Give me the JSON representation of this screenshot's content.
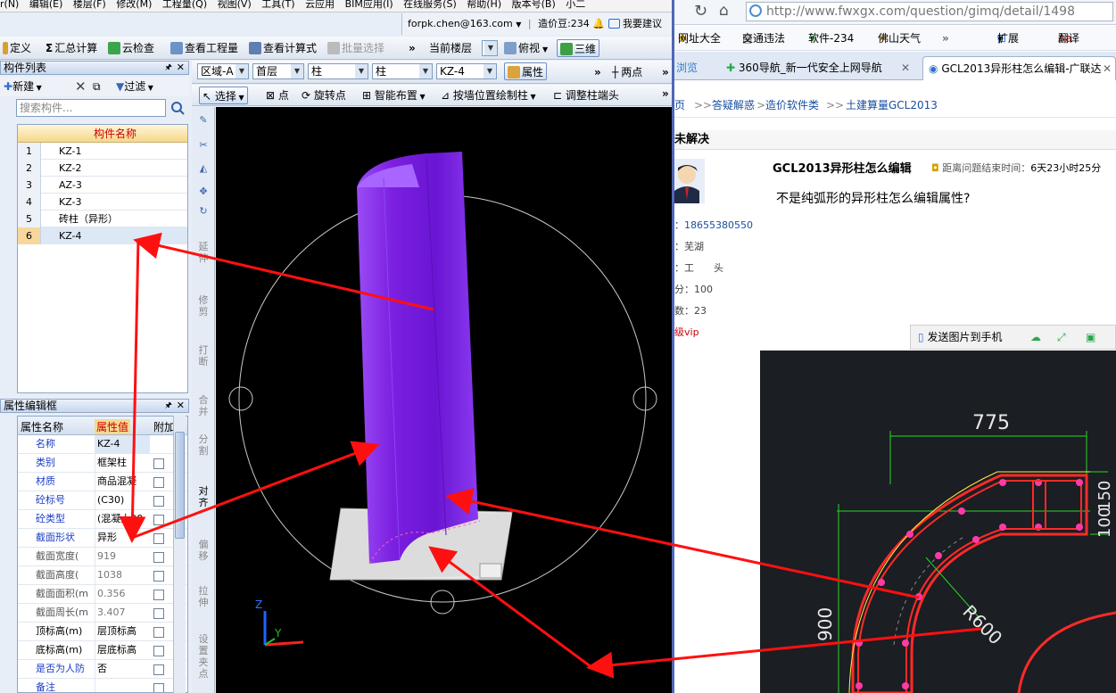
{
  "menubar": {
    "items": [
      "r(N)",
      "编辑(E)",
      "楼层(F)",
      "修改(M)",
      "工程量(Q)",
      "视图(V)",
      "工具(T)",
      "云应用",
      "BIM应用(I)",
      "在线服务(S)",
      "帮助(H)",
      "版本号(B)",
      "小二"
    ]
  },
  "account": {
    "email": "forpk.chen@163.com",
    "coins": "造价豆:234",
    "suggest": "我要建议"
  },
  "toolbar1": {
    "define": "定义",
    "sum": "汇总计算",
    "cloud_check": "云检查",
    "view_qty": "查看工程量",
    "view_formula": "查看计算式",
    "batch_select": "批量选择",
    "current_floor": "当前楼层",
    "top_view": "俯视",
    "three_d": "三维"
  },
  "toolbar2": {
    "region": "区域-A",
    "floor": "首层",
    "type1": "柱",
    "type2": "柱",
    "component": "KZ-4",
    "property": "属性",
    "two_point": "两点"
  },
  "toolbar3": {
    "select": "选择",
    "point": "点",
    "rotate_point": "旋转点",
    "smart_layout": "智能布置",
    "by_wall": "按墙位置绘制柱",
    "adjust_end": "调整柱端头"
  },
  "component_panel": {
    "title": "构件列表",
    "new": "新建",
    "filter": "过滤",
    "search_placeholder": "搜索构件...",
    "header": "构件名称",
    "rows": [
      {
        "n": "1",
        "name": "KZ-1"
      },
      {
        "n": "2",
        "name": "KZ-2"
      },
      {
        "n": "3",
        "name": "AZ-3"
      },
      {
        "n": "4",
        "name": "KZ-3"
      },
      {
        "n": "5",
        "name": "砖柱（异形）"
      },
      {
        "n": "6",
        "name": "KZ-4"
      }
    ]
  },
  "property_panel": {
    "title": "属性编辑框",
    "h_name": "属性名称",
    "h_value": "属性值",
    "h_extra": "附加",
    "rows": [
      {
        "k": "名称",
        "v": "KZ-4"
      },
      {
        "k": "类别",
        "v": "框架柱"
      },
      {
        "k": "材质",
        "v": "商品混凝"
      },
      {
        "k": "砼标号",
        "v": "(C30)"
      },
      {
        "k": "砼类型",
        "v": "(混凝土20"
      },
      {
        "k": "截面形状",
        "v": "异形"
      },
      {
        "k": "截面宽度(",
        "v": "919"
      },
      {
        "k": "截面高度(",
        "v": "1038"
      },
      {
        "k": "截面面积(m",
        "v": "0.356"
      },
      {
        "k": "截面周长(m",
        "v": "3.407"
      },
      {
        "k": "顶标高(m)",
        "v": "层顶标高"
      },
      {
        "k": "底标高(m)",
        "v": "层底标高"
      },
      {
        "k": "是否为人防",
        "v": "否"
      },
      {
        "k": "备注",
        "v": ""
      }
    ]
  },
  "vtools": [
    "延伸",
    "修剪",
    "打断",
    "合并",
    "分割",
    "对齐",
    "偏移",
    "拉伸",
    "设置夹点"
  ],
  "canvas": {
    "axis_z": "Z",
    "axis_y": "Y"
  },
  "browser": {
    "url": "http://www.fwxgx.com/question/gimq/detail/1498",
    "bookmarks": [
      "网址大全",
      "交通违法",
      "软件-234",
      "佛山天气",
      "扩展",
      "翻译"
    ],
    "tabs": [
      "浏览",
      "360导航_新一代安全上网导航",
      "GCL2013异形柱怎么编辑-广联达"
    ],
    "crumbs": [
      "页",
      "答疑解惑",
      "造价软件类",
      "土建算量GCL2013"
    ],
    "status": "未解决",
    "question_title": "GCL2013异形柱怎么编辑",
    "question_meta_label": "距离问题结束时间：",
    "question_meta_value": "6天23小时25分",
    "question_body": "不是纯弧形的异形柱怎么编辑属性?",
    "user_lines": [
      "：18655380550",
      "：芜湖",
      "：工　　头",
      "分：100",
      "数：23",
      "级vip"
    ],
    "send_to_phone": "发送图片到手机",
    "cad": {
      "dim_775": "775",
      "dim_150": "150",
      "dim_100": "100",
      "dim_900": "900",
      "radius": "R600"
    }
  },
  "colors": {
    "column": "#7b1fe0",
    "arrow": "#ff1010",
    "cad_red": "#ff2a2a",
    "cad_green": "#29d629"
  }
}
